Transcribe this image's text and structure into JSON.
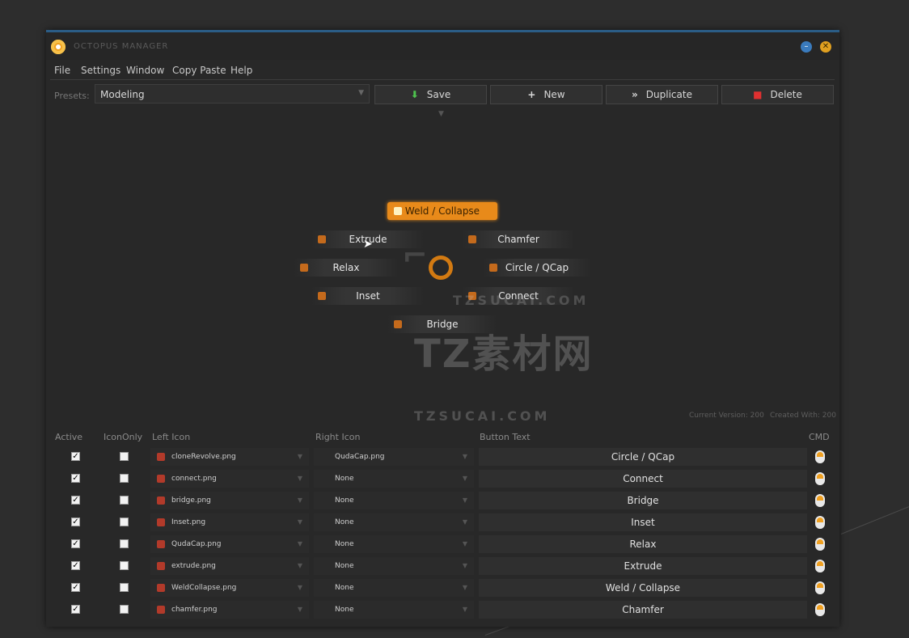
{
  "window": {
    "title": "OCTOPUS MANAGER"
  },
  "menu": [
    "File",
    "Settings",
    "Window",
    "Copy Paste",
    "Help"
  ],
  "presets": {
    "label": "Presets:",
    "value": "Modeling"
  },
  "toolbar": {
    "save": "Save",
    "new": "New",
    "duplicate": "Duplicate",
    "delete": "Delete"
  },
  "canvas_buttons": {
    "weld": "Weld / Collapse",
    "extrude": "Extrude",
    "chamfer": "Chamfer",
    "relax": "Relax",
    "circle": "Circle / QCap",
    "inset": "Inset",
    "connect": "Connect",
    "bridge": "Bridge"
  },
  "watermark": {
    "main": "TZ素材网",
    "url": "TZSUCAI.COM"
  },
  "version": {
    "current": "Current Version: 200",
    "created": "Created With: 200"
  },
  "table": {
    "headers": [
      "Active",
      "IconOnly",
      "Left Icon",
      "Right Icon",
      "Button Text",
      "CMD"
    ],
    "rows": [
      {
        "active": true,
        "icon_only": false,
        "left_icon": "cloneRevolve.png",
        "right_icon": "QudaCap.png",
        "text": "Circle / QCap"
      },
      {
        "active": true,
        "icon_only": false,
        "left_icon": "connect.png",
        "right_icon": "None",
        "text": "Connect"
      },
      {
        "active": true,
        "icon_only": false,
        "left_icon": "bridge.png",
        "right_icon": "None",
        "text": "Bridge"
      },
      {
        "active": true,
        "icon_only": false,
        "left_icon": "Inset.png",
        "right_icon": "None",
        "text": "Inset"
      },
      {
        "active": true,
        "icon_only": false,
        "left_icon": "QudaCap.png",
        "right_icon": "None",
        "text": "Relax"
      },
      {
        "active": true,
        "icon_only": false,
        "left_icon": "extrude.png",
        "right_icon": "None",
        "text": "Extrude"
      },
      {
        "active": true,
        "icon_only": false,
        "left_icon": "WeldCollapse.png",
        "right_icon": "None",
        "text": "Weld / Collapse"
      },
      {
        "active": true,
        "icon_only": false,
        "left_icon": "chamfer.png",
        "right_icon": "None",
        "text": "Chamfer"
      }
    ]
  }
}
